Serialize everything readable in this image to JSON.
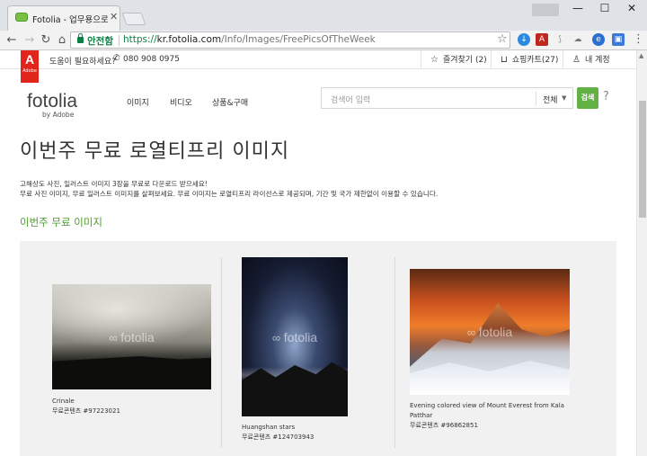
{
  "browser": {
    "tab_title": "Fotolia - 업무용으로 이용",
    "secure_label": "안전함",
    "url_scheme": "https://",
    "url_host": "kr.fotolia.com",
    "url_path": "/Info/Images/FreePicsOfTheWeek"
  },
  "utility_bar": {
    "help_text": "도움이 필요하세요?",
    "phone": "080 908 0975",
    "favorites": "즐겨찾기 (2)",
    "cart": "쇼핑카트(27)",
    "account": "내 계정"
  },
  "header": {
    "logo": "fotolia",
    "logo_sub": "by Adobe",
    "nav": [
      "이미지",
      "비디오",
      "상품&구매"
    ],
    "search_placeholder": "검색어 입력",
    "search_scope": "전체",
    "search_button": "검색",
    "help": "?"
  },
  "main": {
    "title": "이번주 무료 로열티프리 이미지",
    "intro_line1": "고해상도 사진, 일러스트 이미지 3장을 무료로 다운로드 받으세요!",
    "intro_line2": "무료 사진 이미지, 무료 일러스트 이미지를 살펴보세요. 무료 이미지는 로열티프리 라이선스로 제공되며, 기간 및 국가 제한없이 이용할 수 있습니다.",
    "section_title": "이번주 무료 이미지",
    "watermark": "fotolia",
    "images": [
      {
        "title": "Crinale",
        "id": "무료콘텐츠 #97223021"
      },
      {
        "title": "Huangshan stars",
        "id": "무료콘텐츠 #124703943"
      },
      {
        "title": "Evening colored view of Mount Everest from Kala Patthar",
        "id": "무료콘텐츠 #96862851"
      }
    ]
  }
}
